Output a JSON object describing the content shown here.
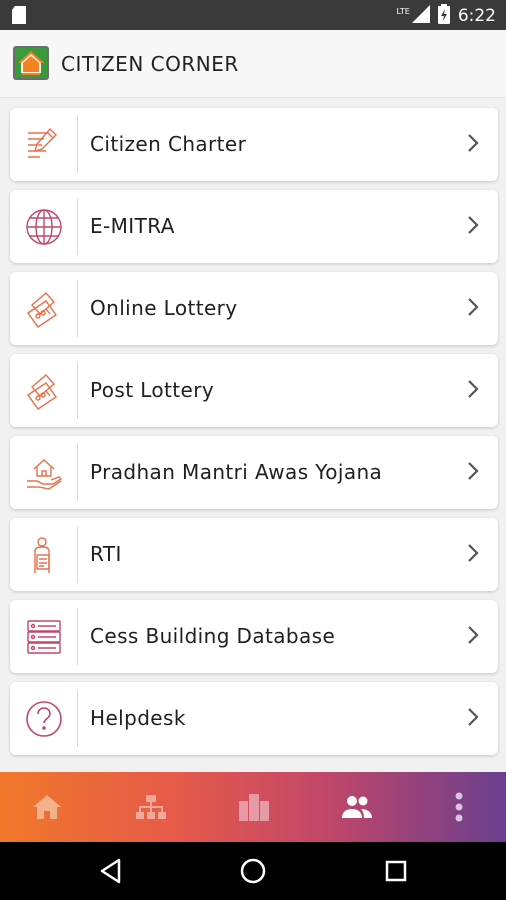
{
  "status_bar": {
    "time": "6:22",
    "network_label": "LTE",
    "icons": [
      "sd-card-icon",
      "signal-icon",
      "battery-icon"
    ]
  },
  "header": {
    "title": "CITIZEN CORNER",
    "logo_icon": "home-logo-icon"
  },
  "menu": {
    "items": [
      {
        "label": "Citizen Charter",
        "icon": "document-edit-icon"
      },
      {
        "label": "E-MITRA",
        "icon": "globe-icon"
      },
      {
        "label": "Online Lottery",
        "icon": "ticket-icon"
      },
      {
        "label": "Post Lottery",
        "icon": "ticket-icon"
      },
      {
        "label": "Pradhan Mantri Awas Yojana",
        "icon": "house-hand-icon"
      },
      {
        "label": "RTI",
        "icon": "person-document-icon"
      },
      {
        "label": "Cess Building Database",
        "icon": "database-icon"
      },
      {
        "label": "Helpdesk",
        "icon": "help-icon"
      }
    ]
  },
  "bottom_nav": {
    "items": [
      "home-icon",
      "hierarchy-icon",
      "buildings-icon",
      "users-icon",
      "more-vertical-icon"
    ],
    "active_index": 3
  },
  "system_nav": [
    "back-icon",
    "home-circle-icon",
    "recents-icon"
  ],
  "colors": {
    "accent_orange": "#f0782a",
    "accent_purple": "#6a3f8e",
    "icon_orange": "#e8704a",
    "status_bar": "#3a3a3a"
  }
}
